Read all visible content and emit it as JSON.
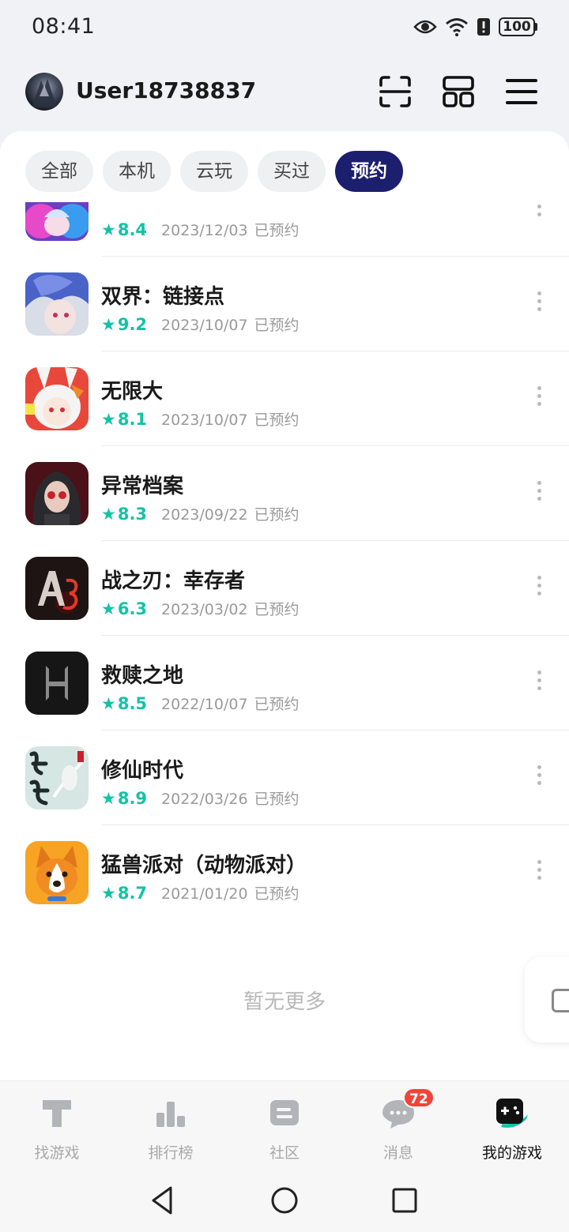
{
  "status_bar": {
    "time": "08:41",
    "battery": "100"
  },
  "header": {
    "username": "User18738837"
  },
  "tabs": [
    {
      "label": "全部"
    },
    {
      "label": "本机"
    },
    {
      "label": "云玩"
    },
    {
      "label": "买过"
    },
    {
      "label": "预约",
      "active": true
    }
  ],
  "games": [
    {
      "title": "",
      "score": "8.4",
      "date": "2023/12/03",
      "status": "已预约",
      "icon": "anime-girl-purple-icon"
    },
    {
      "title": "双界：链接点",
      "score": "9.2",
      "date": "2023/10/07",
      "status": "已预约",
      "icon": "blue-hair-character-icon"
    },
    {
      "title": "无限大",
      "score": "8.1",
      "date": "2023/10/07",
      "status": "已预约",
      "icon": "white-hair-bunny-girl-icon"
    },
    {
      "title": "异常档案",
      "score": "8.3",
      "date": "2023/09/22",
      "status": "已预约",
      "icon": "sunglasses-woman-icon"
    },
    {
      "title": "战之刃：幸存者",
      "score": "6.3",
      "date": "2023/03/02",
      "status": "已预约",
      "icon": "a3-logo-icon"
    },
    {
      "title": "救赎之地",
      "score": "8.5",
      "date": "2022/10/07",
      "status": "已预约",
      "icon": "h-logo-icon"
    },
    {
      "title": "修仙时代",
      "score": "8.9",
      "date": "2022/03/26",
      "status": "已预约",
      "icon": "xiuxian-calligraphy-icon"
    },
    {
      "title": "猛兽派对（动物派对）",
      "score": "8.7",
      "date": "2021/01/20",
      "status": "已预约",
      "icon": "corgi-dog-icon"
    }
  ],
  "list_footer": "暂无更多",
  "bottom_nav": [
    {
      "label": "找游戏",
      "icon": "find-game-icon"
    },
    {
      "label": "排行榜",
      "icon": "ranking-icon"
    },
    {
      "label": "社区",
      "icon": "community-icon"
    },
    {
      "label": "消息",
      "icon": "message-icon",
      "badge": "72"
    },
    {
      "label": "我的游戏",
      "icon": "my-games-icon",
      "active": true
    }
  ],
  "colors": {
    "accent": "#14c2a6",
    "tab_active": "#1c1f6e",
    "badge": "#f0443a"
  }
}
